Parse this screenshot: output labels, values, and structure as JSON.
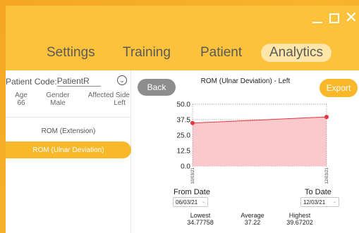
{
  "window": {
    "controls": {
      "minimize": "minimize-icon",
      "maximize": "maximize-icon",
      "close": "close-icon"
    }
  },
  "nav": {
    "items": [
      {
        "label": "Settings",
        "active": false
      },
      {
        "label": "Training",
        "active": false
      },
      {
        "label": "Patient",
        "active": false
      },
      {
        "label": "Analytics",
        "active": true
      }
    ]
  },
  "patient": {
    "code_label": "Patient Code:",
    "code_value": "PatientR",
    "age_label": "Age",
    "age_value": "66",
    "gender_label": "Gender",
    "gender_value": "Male",
    "side_label": "Affected Side",
    "side_value": "Left"
  },
  "sidebar": {
    "items": [
      {
        "label": "ROM (Extension)",
        "active": false
      },
      {
        "label": "ROM (Ulnar Deviation)",
        "active": true
      }
    ]
  },
  "buttons": {
    "back": "Back",
    "export": "Export"
  },
  "chart_data": {
    "type": "area",
    "title": "ROM (Ulnar Deviation) - Left",
    "x": [
      "10/03/21",
      "12/03/21"
    ],
    "y": [
      34.77758,
      39.67202
    ],
    "ylim": [
      0,
      50
    ],
    "yticks": [
      "50.0",
      "37.5",
      "25.0",
      "12.5",
      "0.0"
    ],
    "grid": true,
    "colors": {
      "line": "#e8343c",
      "fill": "#f9c9cb"
    }
  },
  "dates": {
    "from_label": "From Date",
    "from_value": "06/03/21",
    "to_label": "To Date",
    "to_value": "12/03/21"
  },
  "stats": {
    "lowest_label": "Lowest",
    "lowest_value": "34.77758",
    "average_label": "Average",
    "average_value": "37.22",
    "highest_label": "Highest",
    "highest_value": "39.67202"
  },
  "colors": {
    "accent": "#fcc23b",
    "active_item": "#f9b82a",
    "back_button": "#8d8d8d"
  }
}
